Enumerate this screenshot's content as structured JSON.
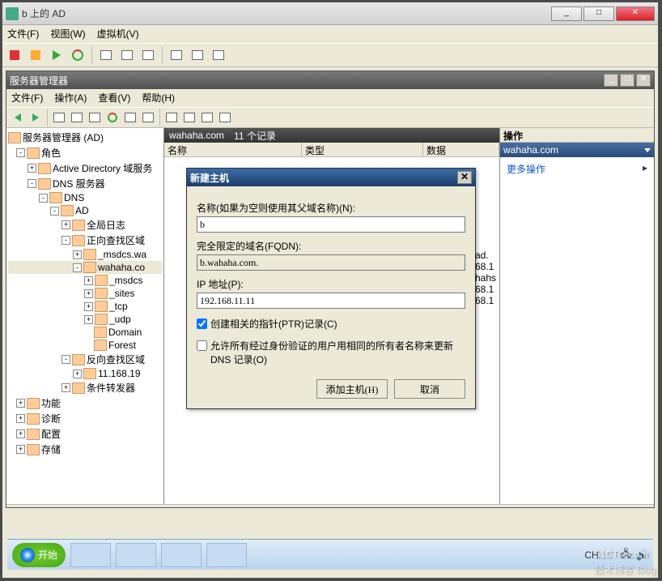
{
  "vm": {
    "title": "b 上的 AD"
  },
  "window_controls": {
    "min": "_",
    "max": "□",
    "close": "✕"
  },
  "menubar": {
    "file": "文件(F)",
    "view": "视图(W)",
    "vm": "虚拟机(V)"
  },
  "inner": {
    "title": "服务器管理器",
    "menu": {
      "file": "文件(F)",
      "action": "操作(A)",
      "view": "查看(V)",
      "help": "帮助(H)"
    }
  },
  "tree": {
    "root": "服务器管理器 (AD)",
    "roles": "角色",
    "ad": "Active Directory 域服务",
    "dnsserver": "DNS 服务器",
    "dns": "DNS",
    "host_ad": "AD",
    "globallog": "全局日志",
    "fwd": "正向查找区域",
    "msdcs": "_msdcs.wa",
    "wahaha": "wahaha.co",
    "sub_msdcs": "_msdcs",
    "sub_sites": "_sites",
    "sub_tcp": "_tcp",
    "sub_udp": "_udp",
    "domain": "Domain",
    "forest": "Forest",
    "rev": "反向查找区域",
    "revzone": "11.168.19",
    "cond": "条件转发器",
    "features": "功能",
    "diag": "诊断",
    "config": "配置",
    "storage": "存储"
  },
  "mid": {
    "zone": "wahaha.com",
    "count": "11 个记录",
    "col_name": "名称",
    "col_type": "类型",
    "col_data": "数据",
    "bg_data": {
      "suffix_ad": "ad.",
      "ip1": "68.1",
      "host": "hahs",
      "ip2": "68.1",
      "ip3": "68.1"
    }
  },
  "right": {
    "header": "操作",
    "zone": "wahaha.com",
    "more": "更多操作"
  },
  "dialog": {
    "title": "新建主机",
    "name_label": "名称(如果为空则使用其父域名称)(N):",
    "name_value": "b",
    "fqdn_label": "完全限定的域名(FQDN):",
    "fqdn_value": "b.wahaha.com.",
    "ip_label": "IP 地址(P):",
    "ip_value": "192.168.11.11",
    "ptr_label": "创建相关的指针(PTR)记录(C)",
    "auth_label": "允许所有经过身份验证的用户用相同的所有者名称来更新 DNS 记录(O)",
    "add": "添加主机(H)",
    "cancel": "取消"
  },
  "taskbar": {
    "start": "开始",
    "lang": "CH"
  },
  "watermark": {
    "main": "51CTO.com",
    "sub": "技术博客 Blog"
  }
}
